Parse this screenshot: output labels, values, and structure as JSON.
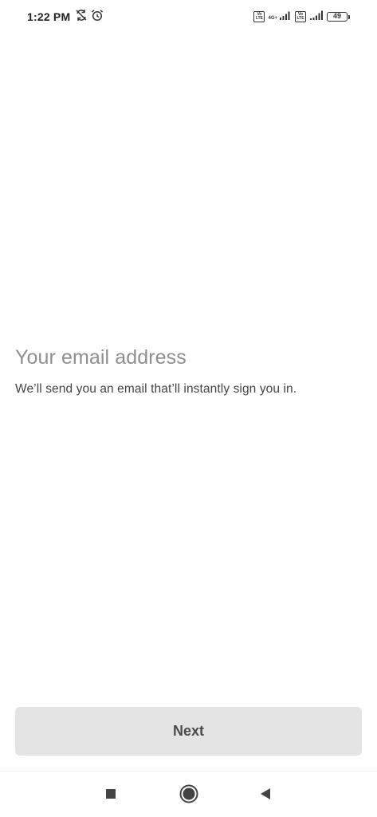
{
  "status_bar": {
    "time": "1:22 PM",
    "icons_left": [
      "sync-off-icon",
      "alarm-icon"
    ],
    "sim1_badge_top": "Vo",
    "sim1_badge_bottom": "LTE",
    "network_type": "4G+",
    "sim2_badge_top": "Vo",
    "sim2_badge_bottom": "LTE",
    "battery_level": "49"
  },
  "main": {
    "title": "Your email address",
    "subtitle": "We’ll send you an email that’ll instantly sign you in."
  },
  "footer": {
    "next_label": "Next"
  },
  "nav_bar": {
    "icons": [
      "recents-square-icon",
      "home-circle-icon",
      "back-triangle-icon"
    ]
  },
  "colors": {
    "title": "#8f8f8f",
    "subtitle": "#444444",
    "button_bg": "#e4e4e4",
    "button_text": "#4a4a4a"
  }
}
